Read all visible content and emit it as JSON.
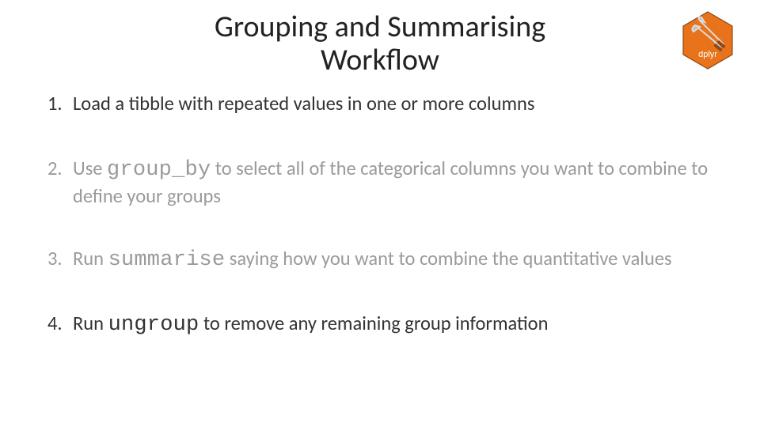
{
  "title_line1": "Grouping and Summarising",
  "title_line2": "Workflow",
  "logo": {
    "label": "dplyr"
  },
  "steps": [
    {
      "num": "1.",
      "pre": "Load a tibble with repeated values in one or more columns",
      "code": "",
      "post": "",
      "faded": false
    },
    {
      "num": "2.",
      "pre": "Use ",
      "code": "group_by",
      "post": " to select all of the categorical columns you want to combine to define your groups",
      "faded": true
    },
    {
      "num": "3.",
      "pre": "Run ",
      "code": "summarise",
      "post": " saying how you want to combine the quantitative values",
      "faded": true
    },
    {
      "num": "4.",
      "pre": "Run ",
      "code": "ungroup",
      "post": " to remove any remaining group information",
      "faded": false
    }
  ]
}
